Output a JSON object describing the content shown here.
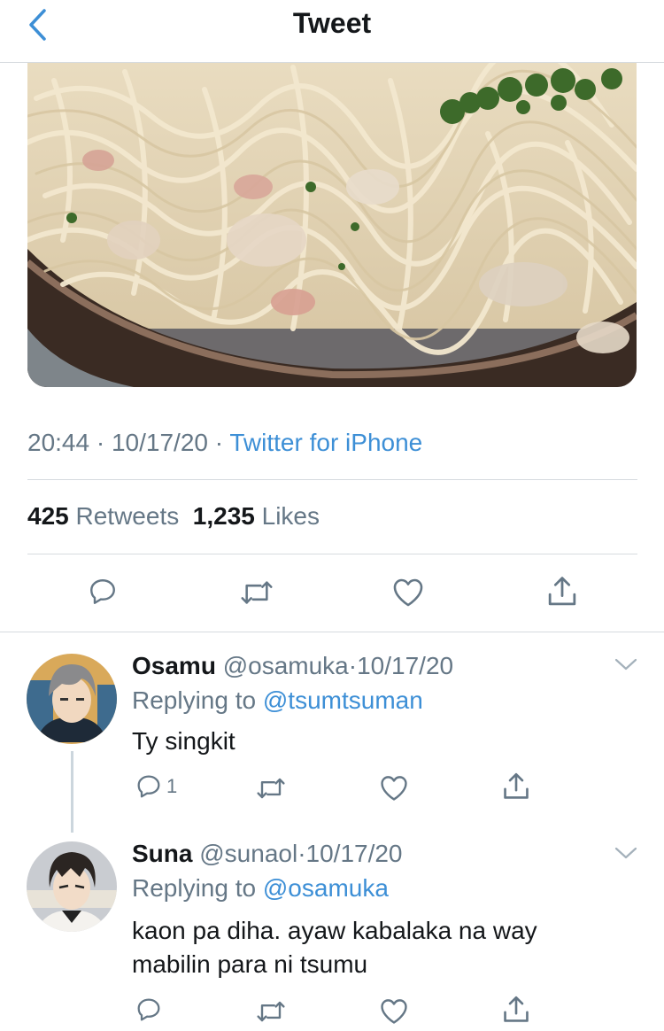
{
  "nav": {
    "title": "Tweet"
  },
  "tweet": {
    "time": "20:44",
    "date": "10/17/20",
    "source": "Twitter for iPhone",
    "retweets_count": "425",
    "retweets_label": "Retweets",
    "likes_count": "1,235",
    "likes_label": "Likes"
  },
  "replies": [
    {
      "name": "Osamu",
      "handle": "@osamuka",
      "date": "10/17/20",
      "replying_label": "Replying to",
      "replying_to": "@tsumtsuman",
      "text": "Ty singkit",
      "reply_count": "1"
    },
    {
      "name": "Suna",
      "handle": "@sunaol",
      "date": "10/17/20",
      "replying_label": "Replying to",
      "replying_to": "@osamuka",
      "text": "kaon pa diha. ayaw kabalaka na way mabilin para ni tsumu"
    }
  ],
  "separator": "·",
  "colors": {
    "accent": "#3d8fd6",
    "muted": "#657786",
    "text": "#14171a",
    "divider": "#d6dbdf"
  },
  "icons": [
    "back-chevron-icon",
    "reply-icon",
    "retweet-icon",
    "like-icon",
    "share-icon",
    "chevron-down-icon"
  ]
}
